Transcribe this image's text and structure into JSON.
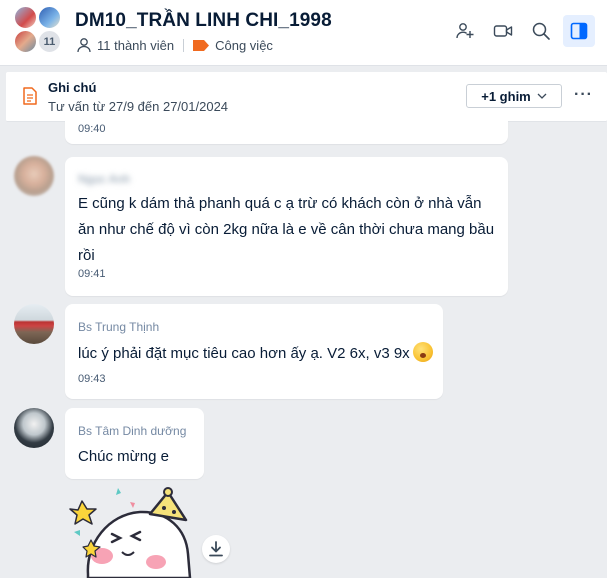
{
  "header": {
    "title": "DM10_TRẦN LINH CHI_1998",
    "avatar_count": "11",
    "members": "11 thành viên",
    "tag": "Công việc",
    "tag_color": "#f06a1f",
    "icons": [
      "add-member-icon",
      "video-call-icon",
      "search-icon",
      "sidebar-toggle-icon"
    ]
  },
  "pinned": {
    "title": "Ghi chú",
    "text": "Tư vấn từ 27/9 đến 27/01/2024",
    "pin_button": "+1 ghim",
    "more": "···"
  },
  "messages": [
    {
      "time": "09:40"
    },
    {
      "sender": "Ngọc Anh",
      "text": "E cũng k dám thả phanh quá c ạ trừ có khách còn ở nhà vẫn ăn như chế độ vì còn 2kg nữa là e về cân thời chưa mang bầu rồi",
      "time": "09:41"
    },
    {
      "sender": "Bs Trung Thịnh",
      "text": "lúc ý phải đặt mục tiêu cao hơn ấy ạ. V2 6x, v3 9x",
      "time": "09:43"
    },
    {
      "sender": "Bs Tâm Dinh dưỡng",
      "text": "Chúc mừng e"
    }
  ],
  "colors": {
    "accent": "#0068ff",
    "background": "#ebedf0",
    "bubble": "#ffffff"
  }
}
